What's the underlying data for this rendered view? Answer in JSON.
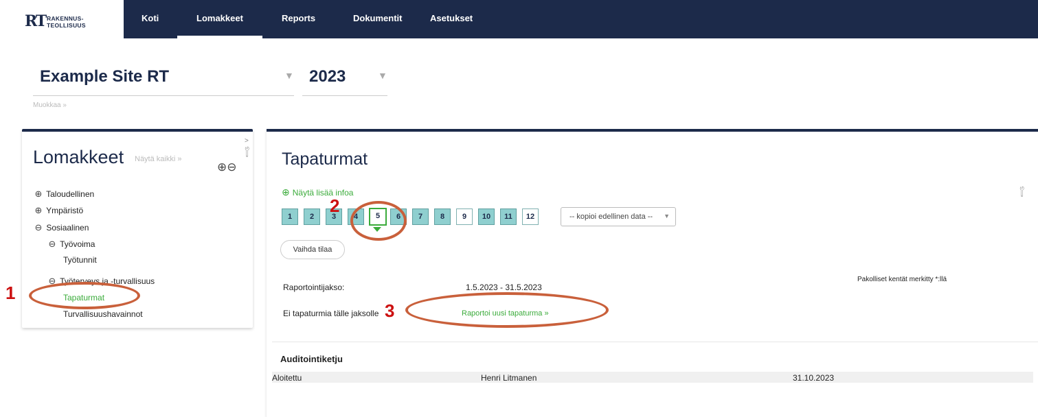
{
  "logo": {
    "mark": "RT",
    "line1": "RAKENNUS-",
    "line2": "TEOLLISUUS"
  },
  "nav": [
    "Koti",
    "Lomakkeet",
    "Reports",
    "Dokumentit",
    "Asetukset"
  ],
  "site": {
    "name": "Example Site RT",
    "year": "2023",
    "edit_link": "Muokkaa »"
  },
  "left_panel": {
    "title": "Lomakkeet",
    "show_all": "Näytä kaikki »",
    "tree": [
      {
        "label": "Taloudellinen"
      },
      {
        "label": "Ympäristö"
      },
      {
        "label": "Sosiaalinen"
      },
      {
        "label": "Työvoima"
      },
      {
        "label": "Työtunnit"
      },
      {
        "label": "Työterveys ja -turvallisuus"
      },
      {
        "label": "Tapaturmat"
      },
      {
        "label": "Turvallisuushavainnot"
      }
    ]
  },
  "main": {
    "title": "Tapaturmat",
    "more_info": "Näytä lisää infoa",
    "months": [
      "1",
      "2",
      "3",
      "4",
      "5",
      "6",
      "7",
      "8",
      "9",
      "10",
      "11",
      "12"
    ],
    "selected_month": "5",
    "copy_dropdown": "-- kopioi edellinen data --",
    "change_state_button": "Vaihda tilaa",
    "required_note": "Pakolliset kentät merkitty *:llä",
    "period_label": "Raportointijakso:",
    "period_value": "1.5.2023 - 31.5.2023",
    "no_accidents": "Ei tapaturmia tälle jaksolle",
    "report_link": "Raportoi uusi tapaturma »",
    "audit": {
      "title": "Auditointiketju",
      "row": {
        "action": "Aloitettu",
        "user": "Henri Litmanen",
        "date": "31.10.2023"
      }
    }
  },
  "annotations": [
    "1",
    "2",
    "3"
  ],
  "colors": {
    "navy": "#1c2a4a",
    "green": "#3aab3a",
    "annotation_red": "#c9603b"
  }
}
